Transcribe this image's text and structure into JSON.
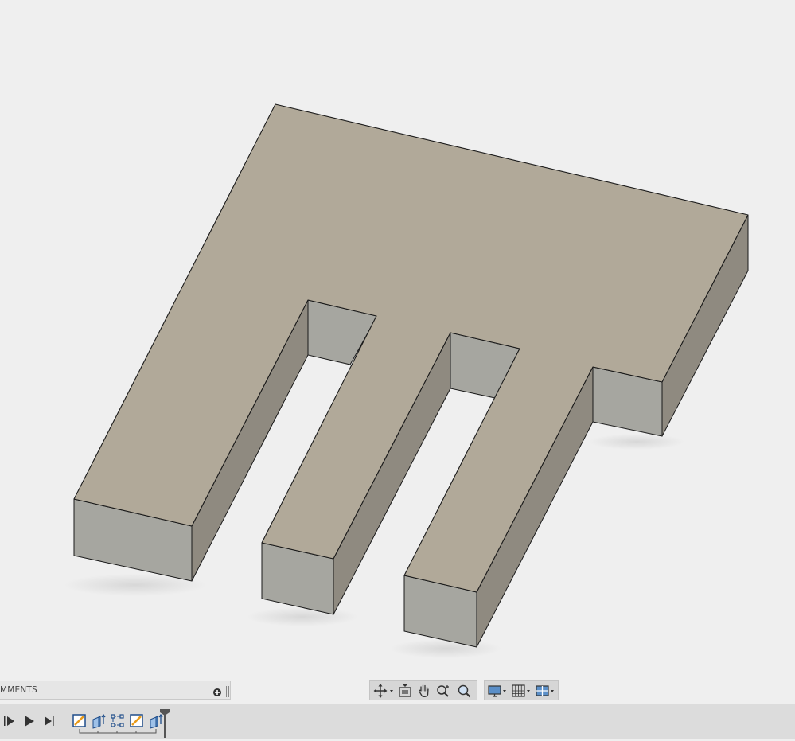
{
  "app": {
    "comments_label": "MMENTS"
  },
  "viewport": {
    "model_top_color": "#b1a999",
    "model_front_color": "#a6a6a0",
    "model_side_color": "#8f8a80",
    "background_color": "#efefef"
  },
  "nav_toolbar": {
    "icons": [
      "orbit-icon",
      "look-at-icon",
      "pan-icon",
      "zoom-icon",
      "fit-icon",
      "display-settings-icon",
      "grid-icon",
      "viewports-icon"
    ]
  },
  "timeline": {
    "controls": [
      "step-back-icon",
      "play-icon",
      "step-end-icon"
    ],
    "features": [
      "sketch-icon",
      "extrude-icon",
      "constraint-icon",
      "sketch-icon",
      "extrude-icon"
    ]
  }
}
